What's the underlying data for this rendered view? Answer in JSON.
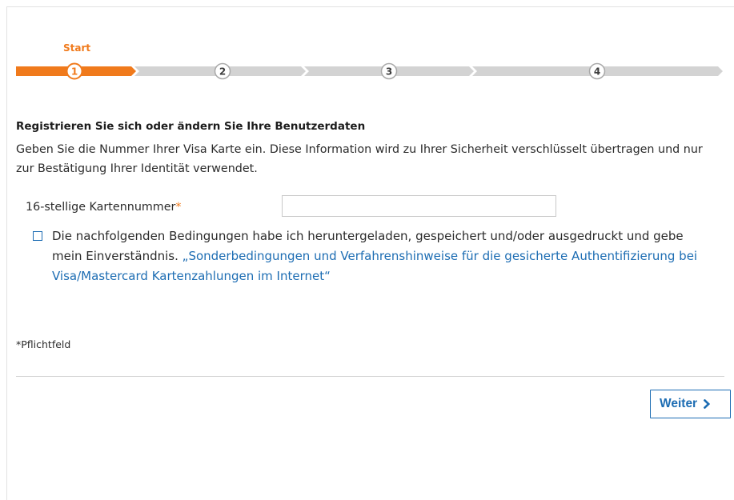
{
  "stepper": {
    "current_label": "Start",
    "current_step": 1,
    "steps": [
      "1",
      "2",
      "3",
      "4"
    ]
  },
  "form": {
    "heading": "Registrieren Sie sich oder ändern Sie Ihre Benutzerdaten",
    "intro_lines": [
      "Geben Sie die Nummer Ihrer Visa Karte ein. Diese Information wird zu Ihrer Sicherheit verschlüsselt übertragen und nur",
      "zur Bestätigung Ihrer Identität verwendet."
    ],
    "card_number": {
      "label": "16-stellige Kartennummer",
      "required_mark": "*",
      "value": ""
    },
    "terms": {
      "checked": false,
      "line1": "Die nachfolgenden Bedingungen habe ich heruntergeladen, gespeichert und/oder ausgedruckt und gebe",
      "line2_prefix": "mein Einverständnis.",
      "link_line1": "„Sonderbedingungen und Verfahrenshinweise für die gesicherte Authentifizierung bei",
      "link_line2": "Visa/Mastercard Kartenzahlungen im Internet“"
    },
    "required_note": "*Pflichtfeld"
  },
  "actions": {
    "next_label": "Weiter",
    "next_icon": "chevron-right-icon"
  },
  "colors": {
    "accent": "#f07a1c",
    "track": "#d3d3d3",
    "link": "#1d6db3",
    "text": "#2b2b2b"
  }
}
